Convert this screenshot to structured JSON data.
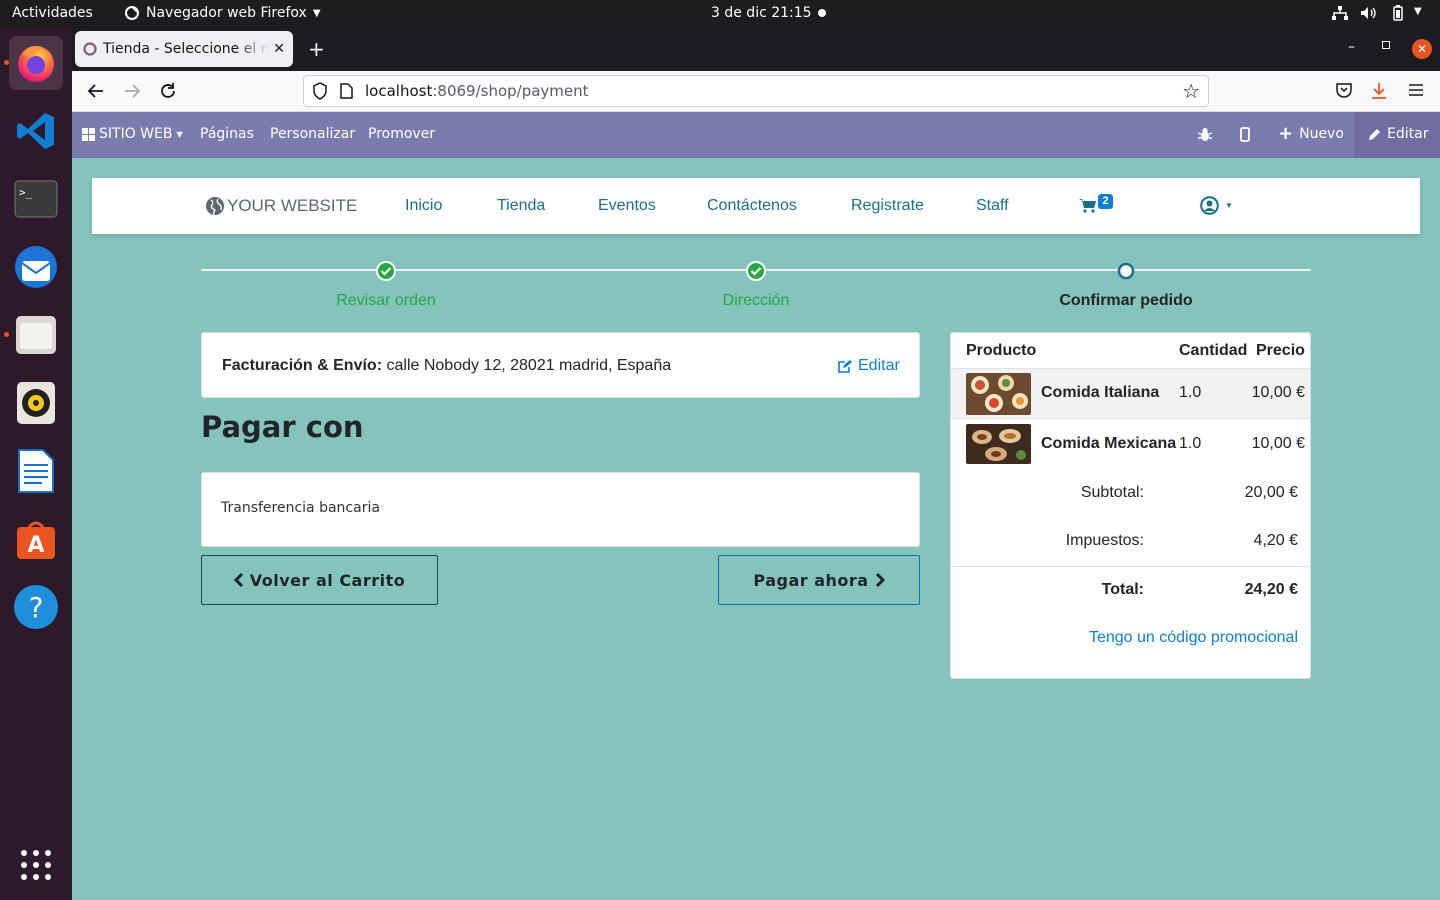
{
  "system": {
    "activities": "Actividades",
    "app_menu": "Navegador web Firefox",
    "clock": "3 de dic  21:15"
  },
  "browser": {
    "tab_title": "Tienda - Seleccione el método de pago",
    "url_host": "localhost",
    "url_path": ":8069/shop/payment"
  },
  "odoo_bar": {
    "website_menu": "SITIO WEB",
    "pages": "Páginas",
    "customize": "Personalizar",
    "promote": "Promover",
    "new": "Nuevo",
    "edit": "Editar"
  },
  "site_header": {
    "logo": "YOUR WEBSITE",
    "menu": [
      "Inicio",
      "Tienda",
      "Eventos",
      "Contáctenos",
      "Registrate",
      "Staff"
    ],
    "cart_count": "2"
  },
  "progress": {
    "steps": [
      "Revisar orden",
      "Dirección",
      "Confirmar pedido"
    ]
  },
  "address_card": {
    "label": "Facturación & Envío:",
    "address": "calle Nobody 12, 28021 madrid, España",
    "edit": "Editar"
  },
  "payment": {
    "heading": "Pagar con",
    "method": "Transferencia bancaria",
    "back_button": "Volver al Carrito",
    "pay_button": "Pagar ahora"
  },
  "summary": {
    "headers": [
      "Producto",
      "Cantidad",
      "Precio"
    ],
    "rows": [
      {
        "name": "Comida Italiana",
        "qty": "1.0",
        "price": "10,00 €"
      },
      {
        "name": "Comida Mexicana",
        "qty": "1.0",
        "price": "10,00 €"
      }
    ],
    "subtotal_label": "Subtotal:",
    "subtotal": "20,00 €",
    "taxes_label": "Impuestos:",
    "taxes": "4,20 €",
    "total_label": "Total:",
    "total": "24,20 €",
    "promo_link": "Tengo un código promocional"
  },
  "colors": {
    "page_bg": "#84c4bd",
    "odoo_bar": "#7c7bad",
    "success": "#28a745",
    "link": "#1c6e88",
    "primary_link": "#0d7dd6"
  }
}
